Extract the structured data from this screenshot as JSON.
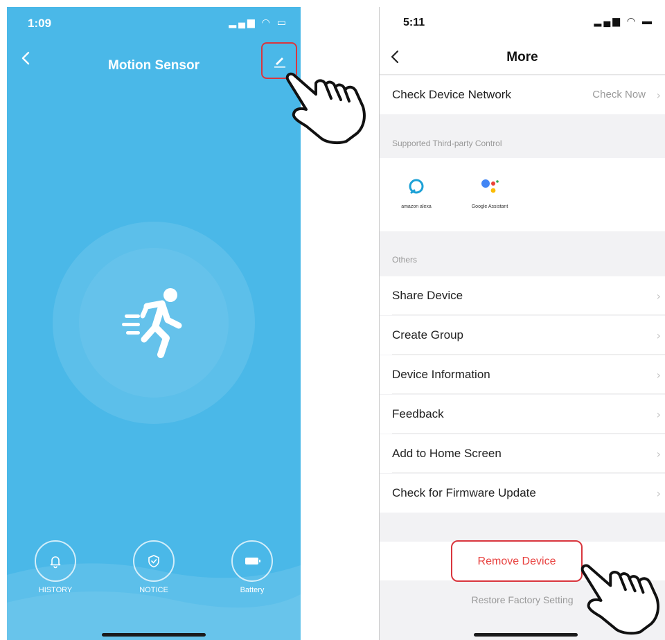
{
  "left_screen": {
    "status_time": "1:09",
    "title": "Motion Sensor",
    "bottom_buttons": [
      {
        "label": "HISTORY",
        "icon": "bell-icon"
      },
      {
        "label": "NOTICE",
        "icon": "shield-icon"
      },
      {
        "label": "Battery",
        "icon": "battery-icon"
      }
    ]
  },
  "right_screen": {
    "status_time": "5:11",
    "title": "More",
    "check_network": {
      "label": "Check Device Network",
      "action": "Check Now"
    },
    "third_party_header": "Supported Third-party Control",
    "third_party": [
      {
        "label": "amazon alexa",
        "icon": "alexa-icon"
      },
      {
        "label": "Google Assistant",
        "icon": "google-assistant-icon"
      }
    ],
    "others_header": "Others",
    "others_items": [
      "Share Device",
      "Create Group",
      "Device Information",
      "Feedback",
      "Add to Home Screen",
      "Check for Firmware Update"
    ],
    "remove_label": "Remove Device",
    "restore_label": "Restore Factory Setting"
  },
  "colors": {
    "left_bg": "#4ab8e8",
    "highlight": "#d9363e",
    "remove_text": "#e8403e"
  }
}
